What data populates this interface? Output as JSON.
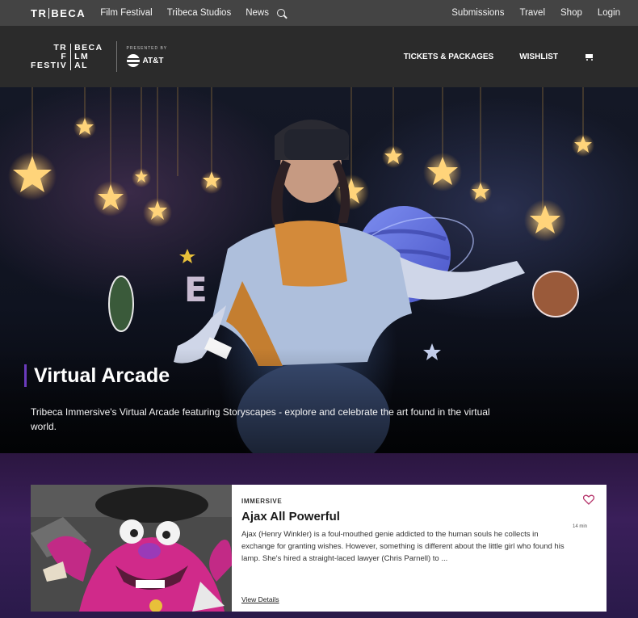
{
  "topbar": {
    "brand": {
      "left": "TR",
      "right": "BECA"
    },
    "nav": [
      "Film Festival",
      "Tribeca Studios",
      "News"
    ],
    "right_nav": [
      "Submissions",
      "Travel",
      "Shop",
      "Login"
    ]
  },
  "festival": {
    "logo": {
      "col_a": [
        "TR",
        "F",
        "FESTIV"
      ],
      "col_b": [
        "BECA",
        "LM",
        "AL"
      ]
    },
    "sponsor_kicker": "PRESENTED BY",
    "sponsor_name": "AT&T",
    "nav": [
      "TICKETS & PACKAGES",
      "WISHLIST"
    ]
  },
  "hero": {
    "title": "Virtual Arcade",
    "description": "Tribeca Immersive's Virtual Arcade featuring Storyscapes - explore and celebrate the art found in the virtual world."
  },
  "card": {
    "category": "IMMERSIVE",
    "title": "Ajax All Powerful",
    "runtime": "14 min",
    "description": "Ajax (Henry Winkler) is a foul-mouthed genie addicted to the human souls he collects in exchange for granting wishes. However, something is different about the little girl who found his lamp. She's hired a straight-laced lawyer (Chris Parnell) to ...",
    "link": "View Details"
  },
  "colors": {
    "accent": "#6b3bbd",
    "heart": "#b5336a"
  }
}
